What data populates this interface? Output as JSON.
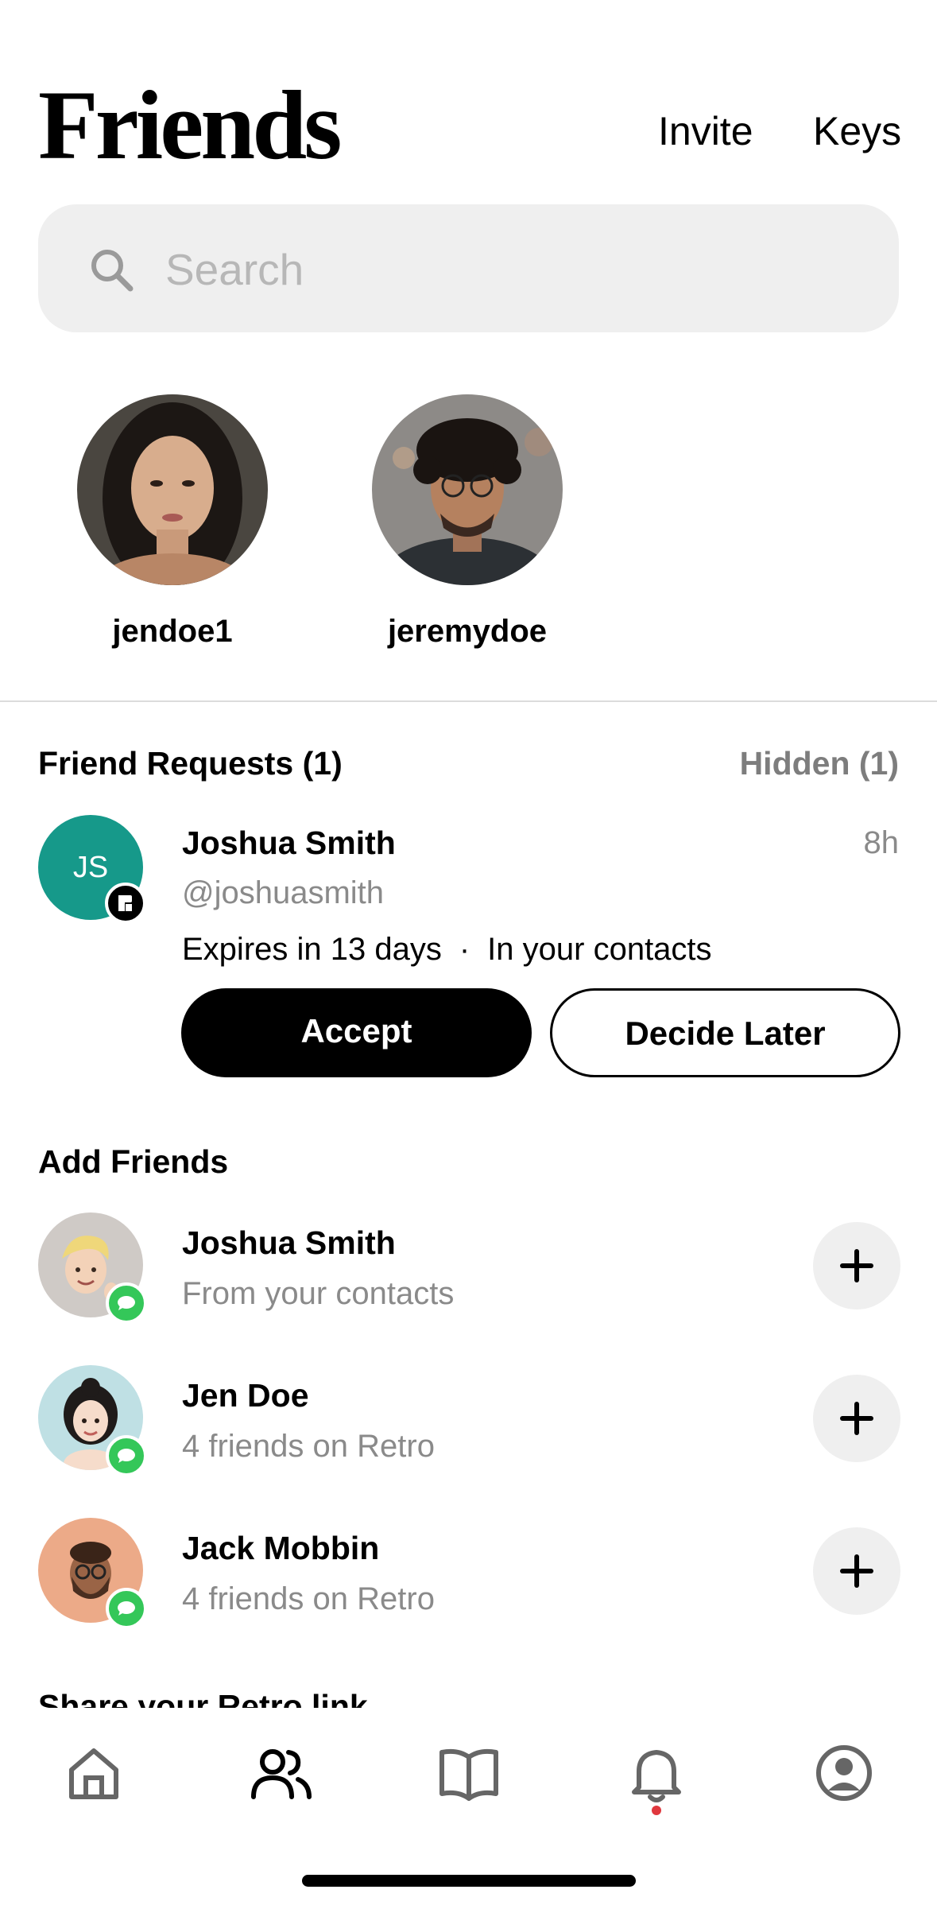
{
  "header": {
    "title": "Friends",
    "invite_label": "Invite",
    "keys_label": "Keys"
  },
  "search": {
    "placeholder": "Search"
  },
  "stories": [
    {
      "username": "jendoe1",
      "avatar": "woman-portrait-photo"
    },
    {
      "username": "jeremydoe",
      "avatar": "man-curly-hair-glasses-photo"
    }
  ],
  "friend_requests": {
    "title": "Friend Requests (1)",
    "hidden_label": "Hidden (1)",
    "items": [
      {
        "initials": "JS",
        "name": "Joshua Smith",
        "handle": "@joshuasmith",
        "time": "8h",
        "expires": "Expires in 13 days",
        "separator": "·",
        "context": "In your contacts",
        "accept_label": "Accept",
        "later_label": "Decide Later",
        "avatar_color": "#16998a",
        "badge_icon": "retro-logo-icon"
      }
    ]
  },
  "add_friends": {
    "title": "Add Friends",
    "items": [
      {
        "name": "Joshua Smith",
        "subtitle": "From your contacts",
        "avatar": "memoji-blond",
        "badge_icon": "message-icon"
      },
      {
        "name": "Jen Doe",
        "subtitle": "4 friends on Retro",
        "avatar": "memoji-woman",
        "badge_icon": "message-icon"
      },
      {
        "name": "Jack Mobbin",
        "subtitle": "4 friends on Retro",
        "avatar": "memoji-bearded",
        "badge_icon": "message-icon"
      }
    ]
  },
  "share": {
    "title": "Share your Retro link"
  },
  "tabbar": {
    "items": [
      "home-icon",
      "friends-icon",
      "journal-icon",
      "notifications-icon",
      "profile-icon"
    ],
    "active": "friends-icon",
    "notification_dot_color": "#e0383e"
  },
  "colors": {
    "accent_green": "#34c759",
    "muted_text": "#8a8a8a",
    "search_bg": "#efefef"
  }
}
